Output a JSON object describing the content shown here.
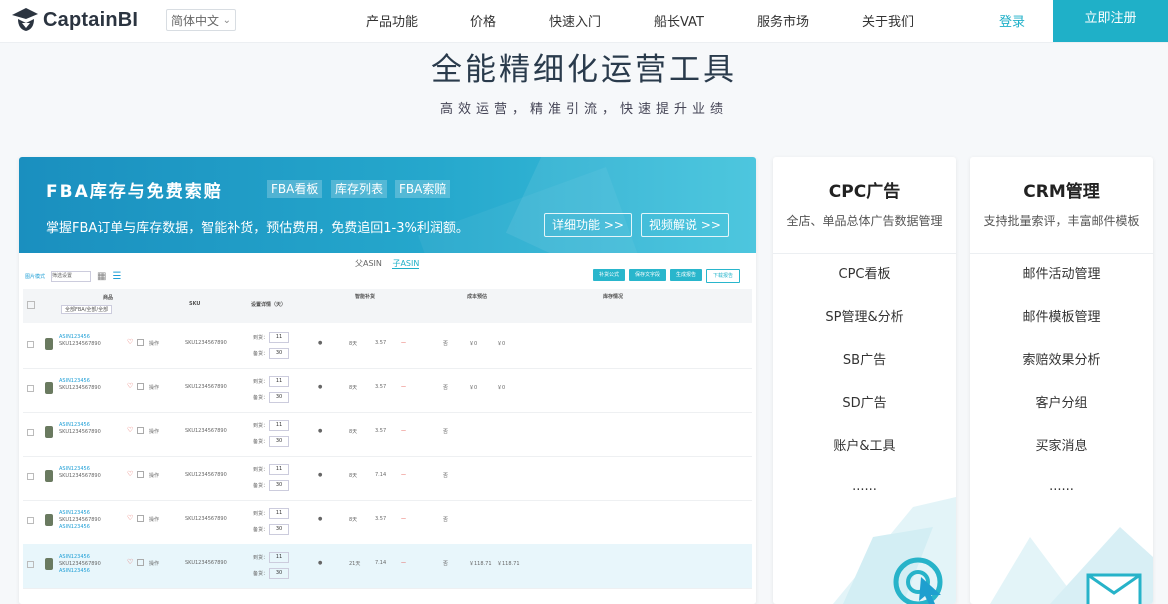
{
  "nav": {
    "brand": "CaptainBI",
    "language": "简体中文",
    "items": [
      "产品功能",
      "价格",
      "快速入门",
      "船长VAT",
      "服务市场",
      "关于我们"
    ],
    "login": "登录",
    "register": "立即注册"
  },
  "hero": {
    "title": "全能精细化运营工具",
    "subtitle": "高效运营，精准引流，快速提升业绩"
  },
  "fba_card": {
    "title": "FBA库存与免费索赔",
    "tags": [
      "FBA看板",
      "库存列表",
      "FBA索赔"
    ],
    "description": "掌握FBA订单与库存数据，智能补货，预估费用，免费追回1-3%利润额。",
    "detail_button": "详细功能 >>",
    "video_button": "视频解说 >>",
    "mock": {
      "tabs": [
        "父ASIN",
        "子ASIN"
      ],
      "mode_label": "图片模式",
      "filter_select": "筛选设置",
      "buttons": [
        "补货公式",
        "保存文字段",
        "生成报告",
        "下载报告"
      ],
      "headers": [
        "商品",
        "SKU",
        "设置详情（天）",
        "智能补货",
        "成本预估",
        "库存情况"
      ],
      "filter_placeholder": "全部FBA/全部/全部",
      "rows": [
        {
          "asin": "ASIN123456",
          "sku": "SKU1234567890",
          "sku2": "SKU1234567890",
          "days": "8天",
          "rate": "3.57",
          "status": "否",
          "price1": "￥0",
          "price2": "￥0",
          "arrive": "11",
          "stock": "30",
          "extra": "",
          "hl": false
        },
        {
          "asin": "ASIN123456",
          "sku": "SKU1234567890",
          "sku2": "SKU1234567890",
          "days": "8天",
          "rate": "3.57",
          "status": "否",
          "price1": "￥0",
          "price2": "￥0",
          "arrive": "11",
          "stock": "30",
          "extra": "",
          "hl": false
        },
        {
          "asin": "ASIN123456",
          "sku": "SKU1234567890",
          "sku2": "SKU1234567890",
          "days": "8天",
          "rate": "3.57",
          "status": "否",
          "price1": "",
          "price2": "",
          "arrive": "11",
          "stock": "30",
          "extra": "",
          "hl": false
        },
        {
          "asin": "ASIN123456",
          "sku": "SKU1234567890",
          "sku2": "SKU1234567890",
          "days": "8天",
          "rate": "7.14",
          "status": "否",
          "price1": "",
          "price2": "",
          "arrive": "11",
          "stock": "30",
          "extra": "",
          "hl": false
        },
        {
          "asin": "ASIN123456",
          "sku": "SKU1234567890",
          "sku2": "SKU1234567890",
          "days": "8天",
          "rate": "3.57",
          "status": "否",
          "price1": "",
          "price2": "",
          "arrive": "11",
          "stock": "30",
          "extra": "ASIN123456",
          "hl": false
        },
        {
          "asin": "ASIN123456",
          "sku": "SKU1234567890",
          "sku2": "SKU1234567890",
          "days": "21天",
          "rate": "7.14",
          "status": "否",
          "price1": "￥118.71",
          "price2": "￥118.71",
          "arrive": "11",
          "stock": "30",
          "extra": "ASIN123456",
          "hl": true
        }
      ],
      "arrive_label": "到货：",
      "stock_label": "备货：",
      "op_label": "操作"
    }
  },
  "cpc_card": {
    "title": "CPC广告",
    "subtitle": "全店、单品总体广告数据管理",
    "items": [
      "CPC看板",
      "SP管理&分析",
      "SB广告",
      "SD广告",
      "账户&工具",
      "......"
    ]
  },
  "crm_card": {
    "title": "CRM管理",
    "subtitle": "支持批量索评，丰富邮件模板",
    "items": [
      "邮件活动管理",
      "邮件模板管理",
      "索赔效果分析",
      "客户分组",
      "买家消息",
      "......"
    ]
  }
}
